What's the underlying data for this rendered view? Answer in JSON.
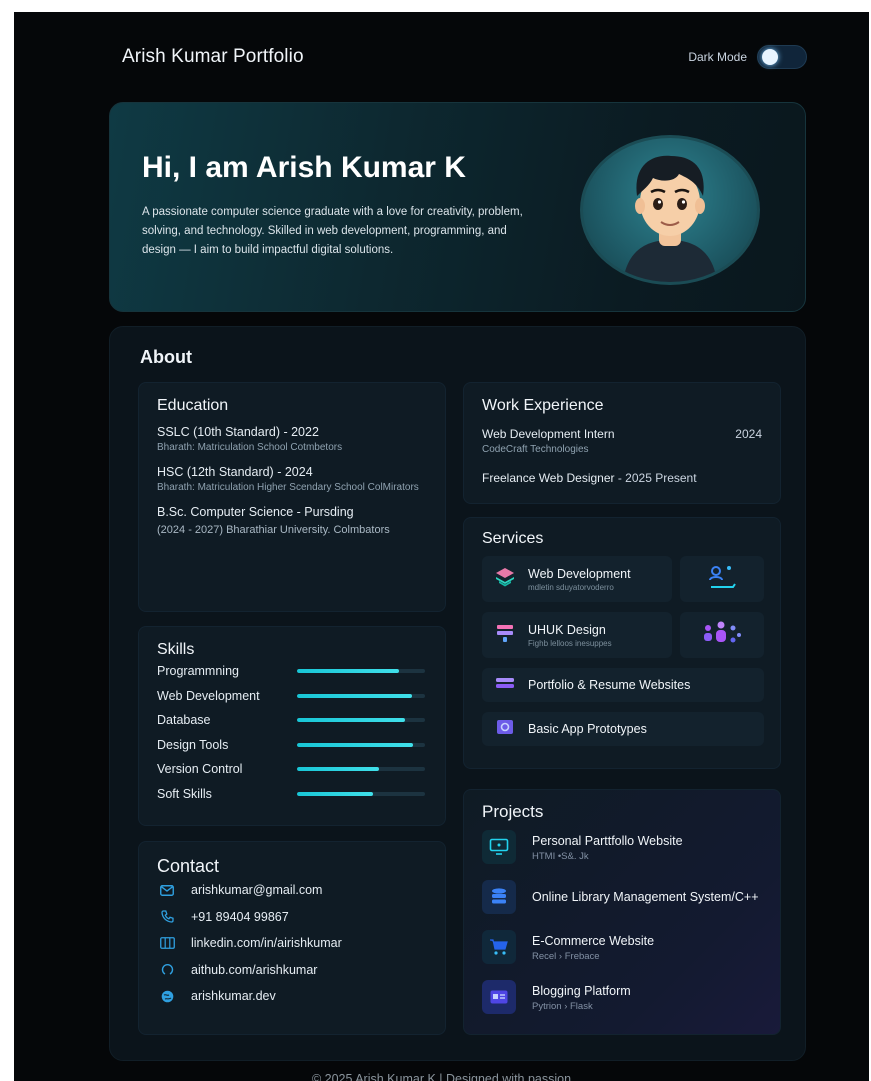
{
  "header": {
    "brand": "Arish Kumar Portfolio",
    "mode_label": "Dark Mode"
  },
  "hero": {
    "title": "Hi, I am Arish Kumar K",
    "intro": "A passionate computer science graduate with a love for creativity, problem, solving, and technology. Skilled in web development, programming, and design — I aim to build impactful digital solutions."
  },
  "about": {
    "title": "About"
  },
  "education": {
    "title": "Education",
    "entries": [
      {
        "head": "SSLC (10th Standard) - 2022",
        "sub": "Bharath: Matriculation School  Cotmbetors"
      },
      {
        "head": "HSC (12th Standard) - 2024",
        "sub": "Bharath: Matriculation Higher Scendary School ColMirators"
      },
      {
        "head": "B.Sc. Computer Science - Pursding",
        "sub": "(2024 - 2027) Bharathiar University. Colmbators"
      }
    ]
  },
  "skills": {
    "title": "Skills",
    "items": [
      {
        "name": "Programmning",
        "level": 0.8
      },
      {
        "name": "Web Development",
        "level": 0.9
      },
      {
        "name": "Database",
        "level": 0.84
      },
      {
        "name": "Design Tools",
        "level": 0.91
      },
      {
        "name": "Version Control",
        "level": 0.64
      },
      {
        "name": "Soft Skills",
        "level": 0.59
      }
    ]
  },
  "contact": {
    "title": "Contact",
    "items": [
      {
        "icon": "mail-icon",
        "text": "arishkumar@gmail.com"
      },
      {
        "icon": "phone-icon",
        "text": "+91 89404 99867"
      },
      {
        "icon": "linkedin-icon",
        "text": "linkedin.com/in/airishkumar"
      },
      {
        "icon": "github-icon",
        "text": "aithub.com/arishkumar"
      },
      {
        "icon": "globe-icon",
        "text": "arishkumar.dev"
      }
    ]
  },
  "work": {
    "title": "Work Experience",
    "first_role": "Web Development Intern",
    "first_company": "CodeCraft Technologies",
    "first_year": "2024",
    "second_role": "Freelance Web Designer",
    "second_period": " - 2025 Present"
  },
  "services": {
    "title": "Services",
    "items": [
      {
        "title": "Web Development",
        "sub": "mdletin sduyatorvoderro",
        "icon": "layers-icon"
      },
      {
        "title": "UHUK Design",
        "sub": "Fighb lelloos inesuppes",
        "icon": "design-icon"
      },
      {
        "title": "Portfolio & Resume Websites",
        "sub": "",
        "icon": "portfolio-icon"
      },
      {
        "title": "Basic App Prototypes",
        "sub": "",
        "icon": "app-icon"
      }
    ]
  },
  "projects": {
    "title": "Projects",
    "items": [
      {
        "title": "Personal Parttfollo Website",
        "sub": "HTMI  •S&. Jk",
        "icon": "monitor-icon"
      },
      {
        "title": "Online Library Management System/C++",
        "sub": "",
        "icon": "database-icon"
      },
      {
        "title": "E-Commerce Website",
        "sub": "Recel › Frebace",
        "icon": "cart-icon"
      },
      {
        "title": "Blogging Platform",
        "sub": "Pytrion › Flask",
        "icon": "blog-icon"
      }
    ]
  },
  "footer": {
    "text": "© 2025 Arish Kumar K | Designed with passion"
  },
  "colors": {
    "accent": "#22c7d6",
    "icon_blue": "#2fa0e0",
    "icon_purple": "#7c6cf2"
  }
}
